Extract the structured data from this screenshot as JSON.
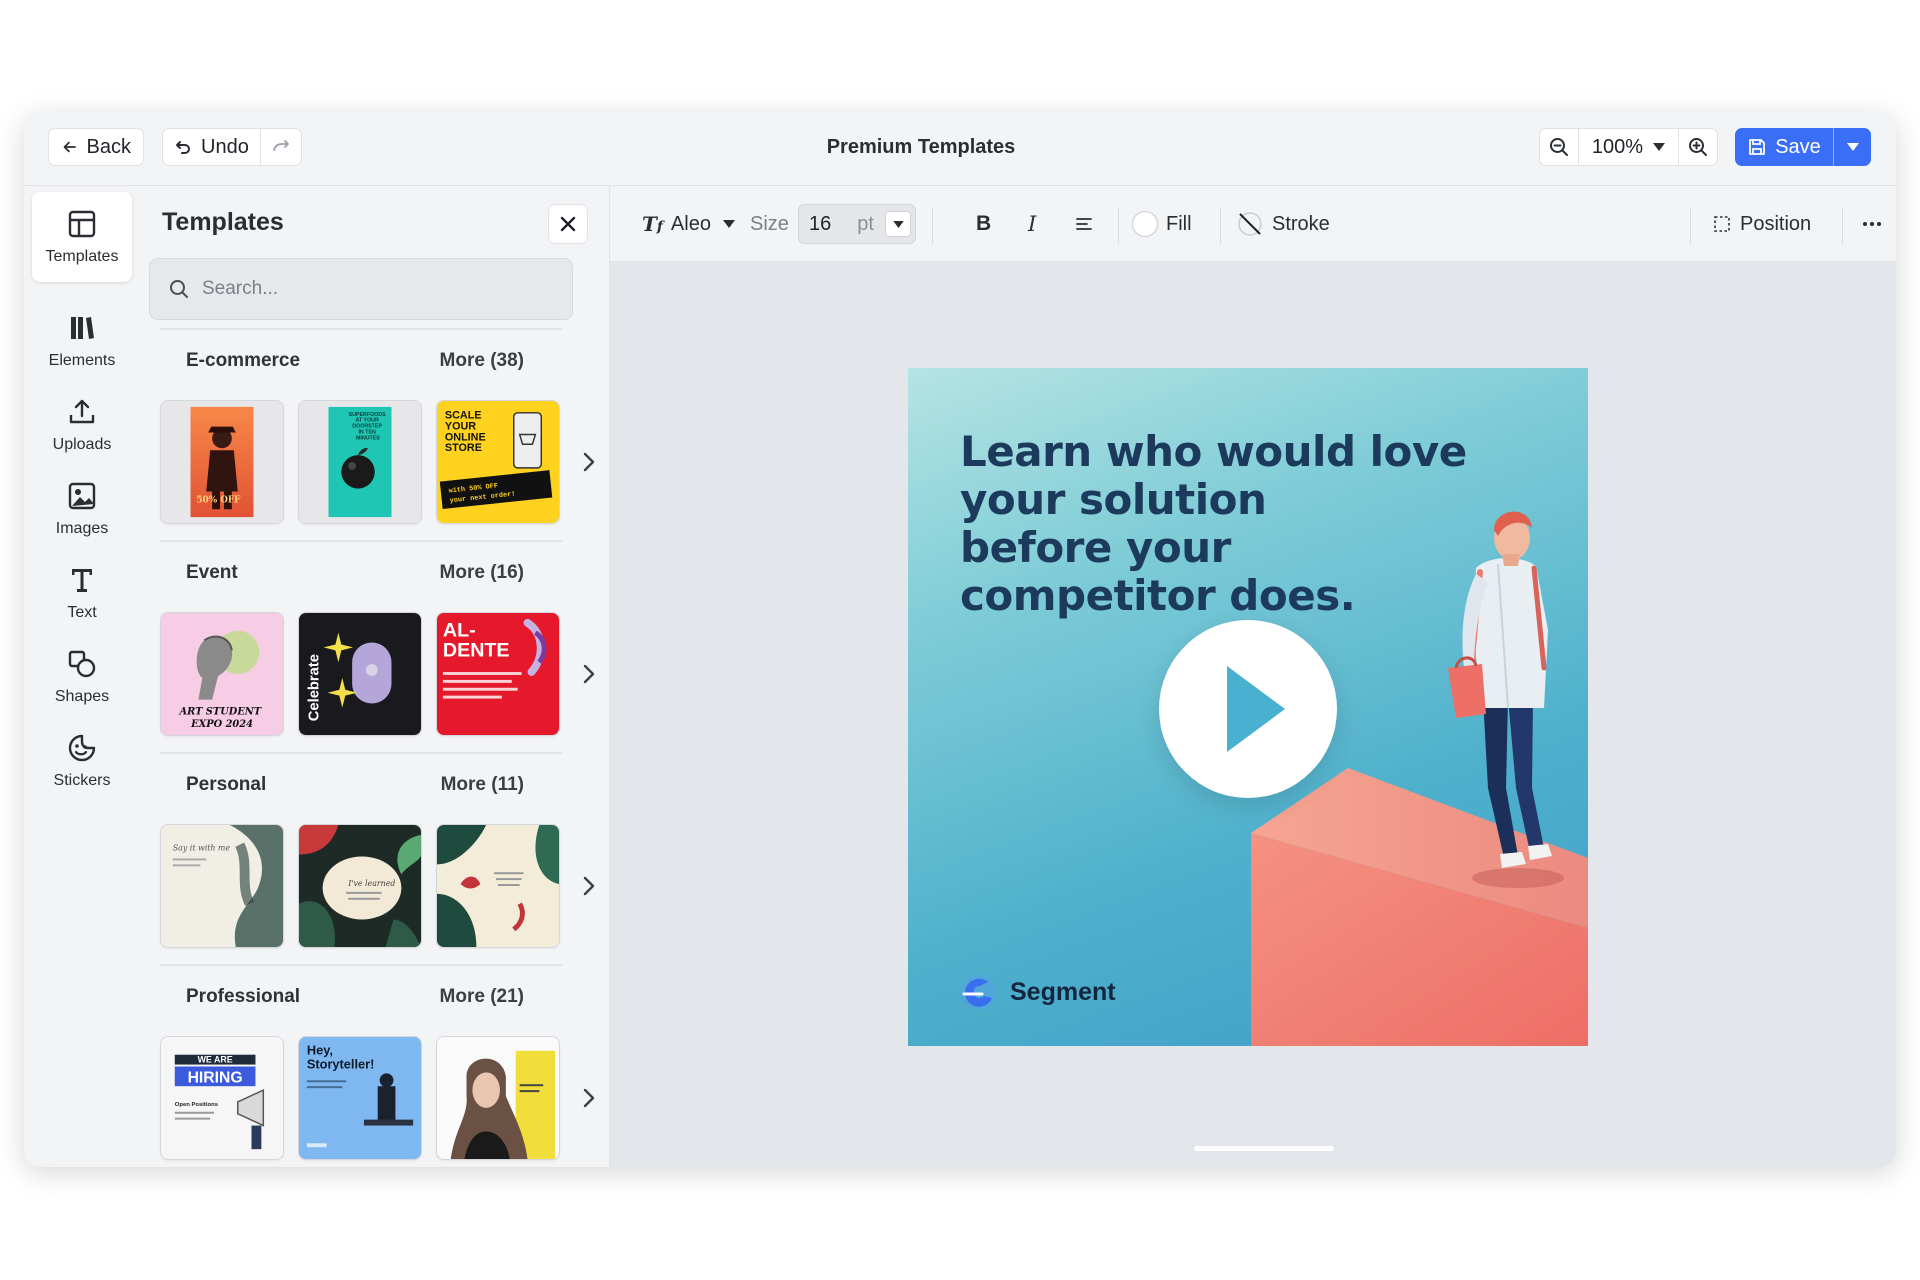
{
  "header": {
    "back_label": "Back",
    "undo_label": "Undo",
    "title": "Premium Templates",
    "zoom": "100%",
    "save_label": "Save"
  },
  "rail": {
    "items": [
      {
        "label": "Templates",
        "icon": "layout-icon",
        "active": true
      },
      {
        "label": "Elements",
        "icon": "elements-icon"
      },
      {
        "label": "Uploads",
        "icon": "upload-icon"
      },
      {
        "label": "Images",
        "icon": "image-icon"
      },
      {
        "label": "Text",
        "icon": "text-icon"
      },
      {
        "label": "Shapes",
        "icon": "shapes-icon"
      },
      {
        "label": "Stickers",
        "icon": "sticker-icon"
      }
    ]
  },
  "panel": {
    "title": "Templates",
    "search_placeholder": "Search...",
    "categories": [
      {
        "name": "E-commerce",
        "more": "More (38)"
      },
      {
        "name": "Event",
        "more": "More (16)"
      },
      {
        "name": "Personal",
        "more": "More (11)"
      },
      {
        "name": "Professional",
        "more": "More (21)"
      }
    ],
    "thumb_text": {
      "scale": [
        "SCALE",
        "YOUR",
        "ONLINE",
        "STORE"
      ],
      "offer": [
        "with 50% OFF",
        "your next order!"
      ],
      "superfoods": [
        "SUPERFOODS",
        "AT YOUR",
        "DOORSTEP",
        "IN TEN",
        "MINUTES"
      ],
      "discount": "50% OFF",
      "expo": [
        "ART STUDENT",
        "EXPO 2024"
      ],
      "celebrate": "Celebrate",
      "al_dente": [
        "AL-",
        "DENTE"
      ],
      "hiring": [
        "WE ARE",
        "HIRING"
      ],
      "positions": "Open Positions",
      "storyteller": [
        "Hey,",
        "Storyteller!"
      ],
      "say": "Say it with me",
      "learned": "I've learned"
    }
  },
  "format": {
    "font": "Aleo",
    "size_label": "Size",
    "size_value": "16",
    "size_unit": "pt",
    "fill_label": "Fill",
    "stroke_label": "Stroke",
    "position_label": "Position"
  },
  "artboard": {
    "headline": [
      "Learn who would love",
      "your solution",
      "before your",
      "competitor does."
    ],
    "brand": "Segment"
  },
  "colors": {
    "accent": "#3b6ef6",
    "artboard_top": "#b5e4e4",
    "artboard_bottom": "#3f9dc6",
    "headline": "#1c3a5c",
    "coral": "#f07c6c"
  }
}
